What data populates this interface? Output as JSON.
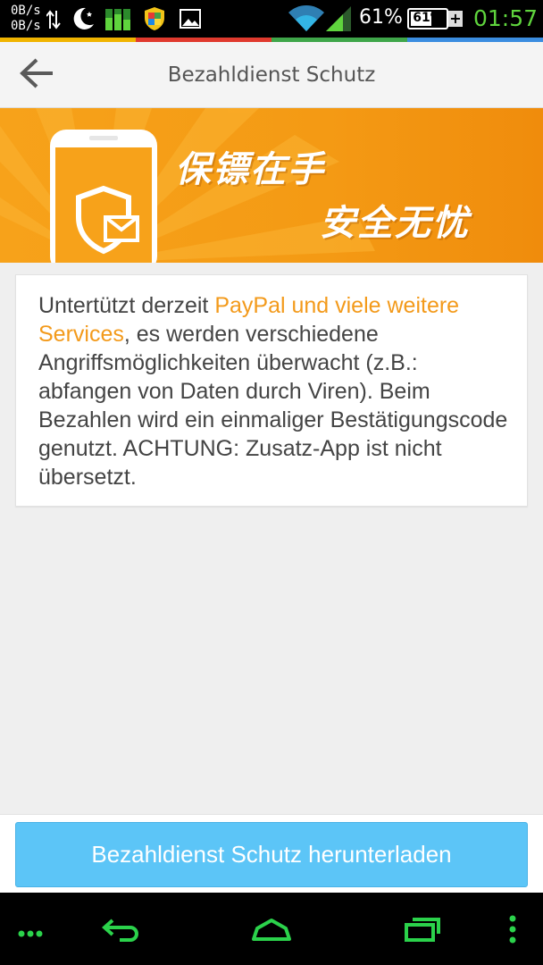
{
  "status_bar": {
    "net_speed_up": "0B/s",
    "net_speed_down": "0B/s",
    "battery_percent": "61%",
    "battery_icon_label": "61%",
    "battery_level": 0.61,
    "time": "01:57",
    "icons": [
      "data-transfer-icon",
      "moon-icon",
      "signal-bars-icon",
      "shield-app-icon",
      "image-icon",
      "wifi-icon",
      "cell-signal-icon",
      "battery-icon",
      "charging-plus-icon"
    ],
    "accent_colors": [
      "#f0b400",
      "#e03a2e",
      "#3fa64a",
      "#3b8de0"
    ]
  },
  "header": {
    "title": "Bezahldienst Schutz",
    "back_icon": "arrow-left-icon"
  },
  "banner": {
    "line1": "保镖在手",
    "line2": "安全无忧",
    "icon": "phone-shield-mail-icon",
    "color": "#f7a21a"
  },
  "card": {
    "text_before": "Untertützt derzeit ",
    "highlight": "PayPal und viele weitere Services",
    "text_after": ", es werden verschiedene Angriffsmöglichkeiten überwacht (z.B.: abfangen von Daten durch Viren). Beim Bezahlen wird ein einmaliger Bestätigungscode genutzt. ACHTUNG: Zusatz-App ist nicht übersetzt.",
    "highlight_color": "#f39a1b"
  },
  "download_button": {
    "label": "Bezahldienst Schutz herunterladen",
    "color": "#5cc5f7"
  },
  "nav_bar": {
    "icons": [
      "menu-dots-icon",
      "back-icon",
      "home-icon",
      "recent-apps-icon",
      "overflow-menu-icon"
    ],
    "color": "#2bd24b"
  }
}
